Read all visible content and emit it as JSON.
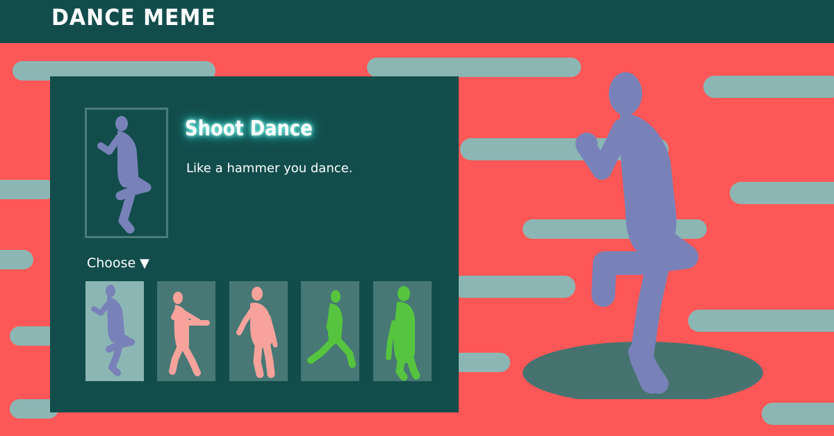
{
  "header": {
    "brand": "DANCE MEME"
  },
  "colors": {
    "background": "#fe5757",
    "panel": "#124d4c",
    "stripe": "#8cb6b3",
    "dancer_blue": "#7882b9",
    "dancer_pink": "#f8a29c",
    "dancer_green": "#56c43e",
    "stage": "#46736f"
  },
  "selected_dance": {
    "title": "Shoot Dance",
    "description": "Like a hammer you dance."
  },
  "chooser": {
    "label": "Choose",
    "arrow": "▼",
    "options": [
      {
        "icon": "shoot-dancer-icon",
        "color": "#7882b9",
        "selected": true
      },
      {
        "icon": "floss-dancer-icon",
        "color": "#f8a29c",
        "selected": false
      },
      {
        "icon": "slouch-dancer-icon",
        "color": "#f8a29c",
        "selected": false
      },
      {
        "icon": "lunge-dancer-icon",
        "color": "#56c43e",
        "selected": false
      },
      {
        "icon": "standing-dancer-icon",
        "color": "#56c43e",
        "selected": false
      }
    ]
  }
}
